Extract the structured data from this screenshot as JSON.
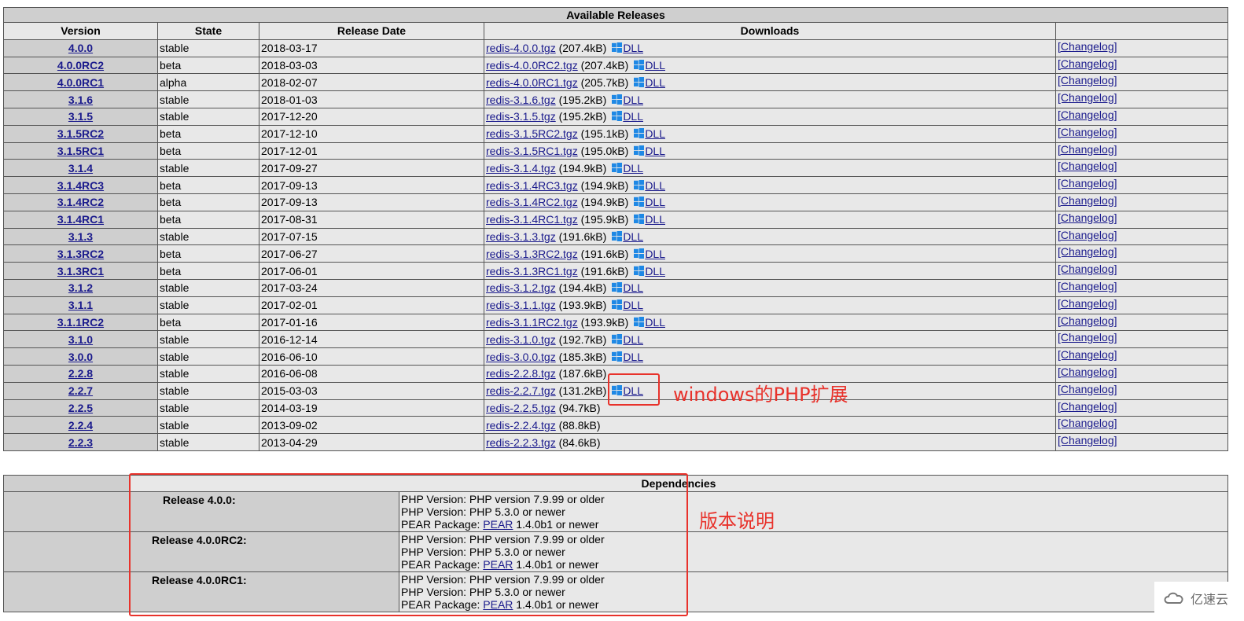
{
  "releases": {
    "title": "Available Releases",
    "columns": [
      "Version",
      "State",
      "Release Date",
      "Downloads"
    ],
    "dll_label": "DLL",
    "changelog_label": "[Changelog]",
    "rows": [
      {
        "version": "4.0.0",
        "state": "stable",
        "date": "2018-03-17",
        "file": "redis-4.0.0.tgz",
        "size": "(207.4kB)",
        "dll": true
      },
      {
        "version": "4.0.0RC2",
        "state": "beta",
        "date": "2018-03-03",
        "file": "redis-4.0.0RC2.tgz",
        "size": "(207.4kB)",
        "dll": true
      },
      {
        "version": "4.0.0RC1",
        "state": "alpha",
        "date": "2018-02-07",
        "file": "redis-4.0.0RC1.tgz",
        "size": "(205.7kB)",
        "dll": true
      },
      {
        "version": "3.1.6",
        "state": "stable",
        "date": "2018-01-03",
        "file": "redis-3.1.6.tgz",
        "size": "(195.2kB)",
        "dll": true
      },
      {
        "version": "3.1.5",
        "state": "stable",
        "date": "2017-12-20",
        "file": "redis-3.1.5.tgz",
        "size": "(195.2kB)",
        "dll": true
      },
      {
        "version": "3.1.5RC2",
        "state": "beta",
        "date": "2017-12-10",
        "file": "redis-3.1.5RC2.tgz",
        "size": "(195.1kB)",
        "dll": true
      },
      {
        "version": "3.1.5RC1",
        "state": "beta",
        "date": "2017-12-01",
        "file": "redis-3.1.5RC1.tgz",
        "size": "(195.0kB)",
        "dll": true
      },
      {
        "version": "3.1.4",
        "state": "stable",
        "date": "2017-09-27",
        "file": "redis-3.1.4.tgz",
        "size": "(194.9kB)",
        "dll": true
      },
      {
        "version": "3.1.4RC3",
        "state": "beta",
        "date": "2017-09-13",
        "file": "redis-3.1.4RC3.tgz",
        "size": "(194.9kB)",
        "dll": true
      },
      {
        "version": "3.1.4RC2",
        "state": "beta",
        "date": "2017-09-13",
        "file": "redis-3.1.4RC2.tgz",
        "size": "(194.9kB)",
        "dll": true
      },
      {
        "version": "3.1.4RC1",
        "state": "beta",
        "date": "2017-08-31",
        "file": "redis-3.1.4RC1.tgz",
        "size": "(195.9kB)",
        "dll": true
      },
      {
        "version": "3.1.3",
        "state": "stable",
        "date": "2017-07-15",
        "file": "redis-3.1.3.tgz",
        "size": "(191.6kB)",
        "dll": true
      },
      {
        "version": "3.1.3RC2",
        "state": "beta",
        "date": "2017-06-27",
        "file": "redis-3.1.3RC2.tgz",
        "size": "(191.6kB)",
        "dll": true
      },
      {
        "version": "3.1.3RC1",
        "state": "beta",
        "date": "2017-06-01",
        "file": "redis-3.1.3RC1.tgz",
        "size": "(191.6kB)",
        "dll": true
      },
      {
        "version": "3.1.2",
        "state": "stable",
        "date": "2017-03-24",
        "file": "redis-3.1.2.tgz",
        "size": "(194.4kB)",
        "dll": true
      },
      {
        "version": "3.1.1",
        "state": "stable",
        "date": "2017-02-01",
        "file": "redis-3.1.1.tgz",
        "size": "(193.9kB)",
        "dll": true
      },
      {
        "version": "3.1.1RC2",
        "state": "beta",
        "date": "2017-01-16",
        "file": "redis-3.1.1RC2.tgz",
        "size": "(193.9kB)",
        "dll": true
      },
      {
        "version": "3.1.0",
        "state": "stable",
        "date": "2016-12-14",
        "file": "redis-3.1.0.tgz",
        "size": "(192.7kB)",
        "dll": true
      },
      {
        "version": "3.0.0",
        "state": "stable",
        "date": "2016-06-10",
        "file": "redis-3.0.0.tgz",
        "size": "(185.3kB)",
        "dll": true
      },
      {
        "version": "2.2.8",
        "state": "stable",
        "date": "2016-06-08",
        "file": "redis-2.2.8.tgz",
        "size": "(187.6kB)",
        "dll": false
      },
      {
        "version": "2.2.7",
        "state": "stable",
        "date": "2015-03-03",
        "file": "redis-2.2.7.tgz",
        "size": "(131.2kB)",
        "dll": true
      },
      {
        "version": "2.2.5",
        "state": "stable",
        "date": "2014-03-19",
        "file": "redis-2.2.5.tgz",
        "size": "(94.7kB)",
        "dll": false
      },
      {
        "version": "2.2.4",
        "state": "stable",
        "date": "2013-09-02",
        "file": "redis-2.2.4.tgz",
        "size": "(88.8kB)",
        "dll": false
      },
      {
        "version": "2.2.3",
        "state": "stable",
        "date": "2013-04-29",
        "file": "redis-2.2.3.tgz",
        "size": "(84.6kB)",
        "dll": false
      }
    ]
  },
  "dependencies": {
    "title": "Dependencies",
    "pear_link": "PEAR",
    "releases": [
      {
        "label": "Release 4.0.0:",
        "lines": [
          "PHP Version: PHP version 7.9.99 or older",
          "PHP Version: PHP 5.3.0 or newer"
        ],
        "pear_prefix": "PEAR Package: ",
        "pear_suffix": " 1.4.0b1 or newer"
      },
      {
        "label": "Release 4.0.0RC2:",
        "lines": [
          "PHP Version: PHP version 7.9.99 or older",
          "PHP Version: PHP 5.3.0 or newer"
        ],
        "pear_prefix": "PEAR Package: ",
        "pear_suffix": " 1.4.0b1 or newer"
      },
      {
        "label": "Release 4.0.0RC1:",
        "lines": [
          "PHP Version: PHP version 7.9.99 or older",
          "PHP Version: PHP 5.3.0 or newer"
        ],
        "pear_prefix": "PEAR Package: ",
        "pear_suffix": " 1.4.0b1 or newer"
      }
    ]
  },
  "annotations": {
    "dll_note": "windows的PHP扩展",
    "version_note": "版本说明",
    "color": "#e8322b"
  },
  "watermark": {
    "text": "亿速云"
  },
  "colors": {
    "link": "#1a1a8c",
    "windows_logo": "#1e88e5",
    "version_cell": "#cfcfcf",
    "row_bg": "#e8e8e8"
  }
}
